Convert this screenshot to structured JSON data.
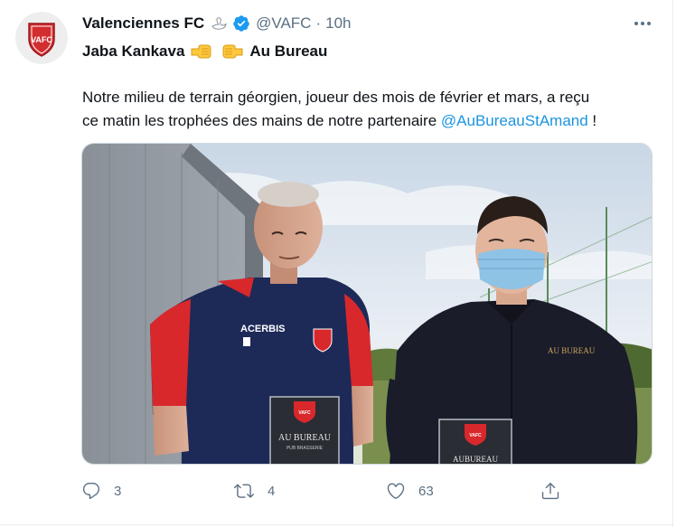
{
  "tweet": {
    "author_name": "Valenciennes FC",
    "handle": "@VAFC",
    "separator": "·",
    "time": "10h",
    "avatar_text": "VAFC",
    "subline_left": "Jaba Kankava",
    "subline_right": "Au Bureau",
    "body_line1": "Notre milieu de terrain géorgien, joueur des mois de février et mars, a reçu",
    "body_line2_prefix": "ce matin les trophées des mains de notre partenaire ",
    "body_mention": "@AuBureauStAmand",
    "body_suffix": " !"
  },
  "photo": {
    "jersey_sponsor": "ACERBIS",
    "trophy1_brand": "AU BUREAU",
    "trophy1_sub": "PUB BRASSERIE",
    "shirt_logo": "AU BUREAU",
    "trophy2_brand": "AUBUREAU",
    "crest_text": "VAFC"
  },
  "actions": {
    "reply_count": "3",
    "retweet_count": "4",
    "like_count": "63"
  },
  "icons": [
    "swan-icon",
    "verified-badge-icon",
    "more-icon",
    "fist-bump-left-icon",
    "fist-bump-right-icon",
    "reply-icon",
    "retweet-icon",
    "like-icon",
    "share-icon"
  ],
  "colors": {
    "accent": "#1b95e0",
    "secondary_text": "#5b7083",
    "club_red": "#d22d2f"
  }
}
